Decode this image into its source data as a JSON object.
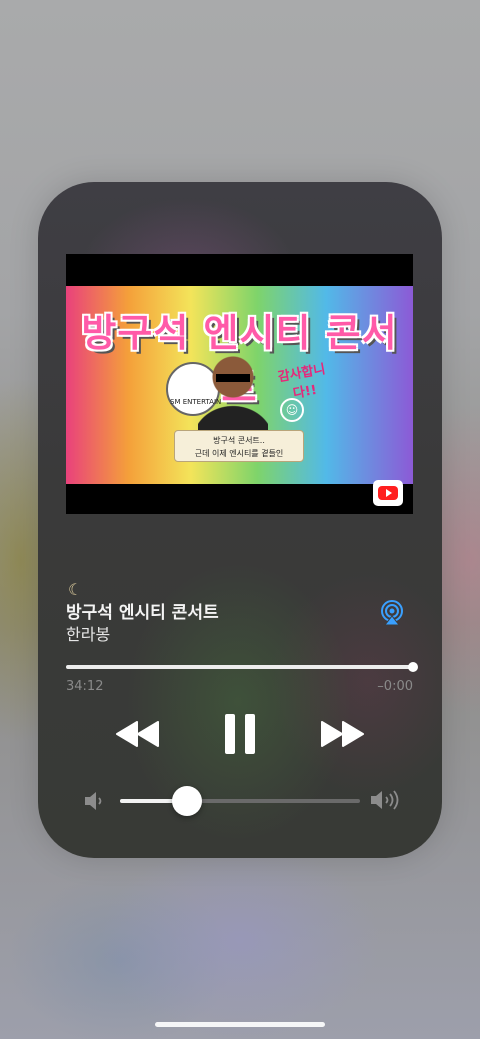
{
  "now_playing": {
    "artwork": {
      "title_text": "방구석 엔시티 콘서트",
      "logo_text": "SM ENTERTAIN",
      "thanks_text": "감사합니다!!",
      "smile_glyph": "☺",
      "scroll_line1": "방구석 콘서트..",
      "scroll_line2": "근데 이제 엔시티를 곁들인",
      "source_icon": "youtube-icon"
    },
    "sleep_icon": "☾",
    "title": "방구석 엔시티 콘서트",
    "artist": "한라봉",
    "airplay_icon": "airplay-icon",
    "progress": {
      "elapsed": "34:12",
      "remaining": "–0:00",
      "fraction": 1.0
    },
    "controls": {
      "rewind_icon": "rewind-icon",
      "pause_icon": "pause-icon",
      "forward_icon": "fast-forward-icon"
    },
    "volume": {
      "level": 0.28,
      "low_icon": "speaker-low-icon",
      "high_icon": "speaker-high-icon"
    }
  },
  "colors": {
    "accent_airplay": "#3aa0ff",
    "card_bg": "#3c3c3e",
    "progress_fill": "#ededed"
  }
}
